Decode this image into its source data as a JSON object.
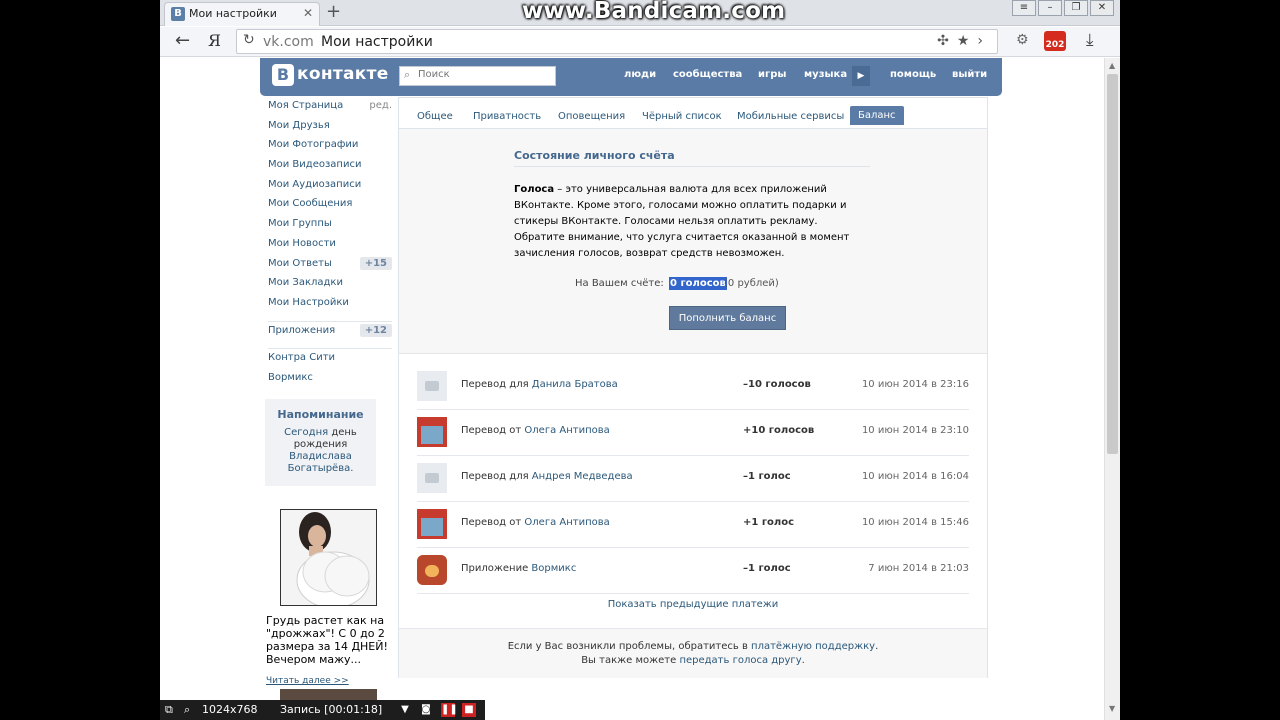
{
  "browser": {
    "tab_title": "Мои настройки",
    "tab_favicon": "В",
    "new_tab": "+",
    "watermark": "www.Bandicam.com",
    "address_host": "vk.com",
    "address_title": "Мои настройки",
    "ya_label": "Я",
    "badge_count": "202"
  },
  "vk": {
    "logo_letter": "В",
    "logo_text": "контакте",
    "search_placeholder": "Поиск",
    "nav": [
      "люди",
      "сообщества",
      "игры",
      "музыка",
      "помощь",
      "выйти"
    ]
  },
  "sidebar": {
    "edit_label": "ред.",
    "items": [
      {
        "label": "Моя Страница"
      },
      {
        "label": "Мои Друзья"
      },
      {
        "label": "Мои Фотографии"
      },
      {
        "label": "Мои Видеозаписи"
      },
      {
        "label": "Мои Аудиозаписи"
      },
      {
        "label": "Мои Сообщения"
      },
      {
        "label": "Мои Группы"
      },
      {
        "label": "Мои Новости"
      },
      {
        "label": "Мои Ответы",
        "count": "+15"
      },
      {
        "label": "Мои Закладки"
      },
      {
        "label": "Мои Настройки"
      }
    ],
    "apps": {
      "label": "Приложения",
      "count": "+12"
    },
    "extra": [
      "Контра Сити",
      "Вормикс"
    ]
  },
  "reminder": {
    "title": "Напоминание",
    "text_today": "Сегодня",
    "text_day": "день рождения",
    "text_name": "Владислава Богатырёва."
  },
  "ad": {
    "title": "Грудь растет как на \"дрожжах\"! С 0 до 2 размера за 14 ДНЕЙ! Вечером мажу...",
    "more": "Читать далее >>"
  },
  "tabs": [
    "Общее",
    "Приватность",
    "Оповещения",
    "Чёрный список",
    "Мобильные сервисы",
    "Баланс"
  ],
  "balance": {
    "title": "Состояние личного счёта",
    "desc_bold": "Голоса",
    "desc_rest": " – это универсальная валюта для всех приложений ВКонтакте. Кроме этого, голосами можно оплатить подарки и стикеры ВКонтакте. Голосами нельзя оплатить рекламу. Обратите внимание, что услуга считается оказанной в момент зачисления голосов, возврат средств невозможен.",
    "label": "На Вашем счёте:",
    "value": "0 голосов",
    "rub": "(0 рублей)",
    "button": "Пополнить баланс"
  },
  "transactions": [
    {
      "avatar": "camera-icon",
      "prefix": "Перевод для",
      "name": "Данила Братова",
      "amount": "–10 голосов",
      "date": "10 июн 2014 в 23:16"
    },
    {
      "avatar": "user-avatar",
      "prefix": "Перевод от",
      "name": "Олега Антипова",
      "amount": "+10 голосов",
      "date": "10 июн 2014 в 23:10"
    },
    {
      "avatar": "camera-icon",
      "prefix": "Перевод для",
      "name": "Андрея Медведева",
      "amount": "–1 голос",
      "date": "10 июн 2014 в 16:04"
    },
    {
      "avatar": "user-avatar",
      "prefix": "Перевод от",
      "name": "Олега Антипова",
      "amount": "+1 голос",
      "date": "10 июн 2014 в 15:46"
    },
    {
      "avatar": "app-icon",
      "prefix": "Приложение",
      "name": "Вормикс",
      "amount": "–1 голос",
      "date": "7 июн 2014 в 21:03"
    }
  ],
  "show_prev": "Показать предыдущие платежи",
  "footer": {
    "line1_text": "Если у Вас возникли проблемы, обратитесь в ",
    "line1_link": "платёжную поддержку",
    "line1_end": ".",
    "line2_text": "Вы также можете ",
    "line2_link": "передать голоса другу",
    "line2_end": "."
  },
  "recorder": {
    "resolution": "1024x768",
    "status": "Запись [00:01:18]"
  }
}
